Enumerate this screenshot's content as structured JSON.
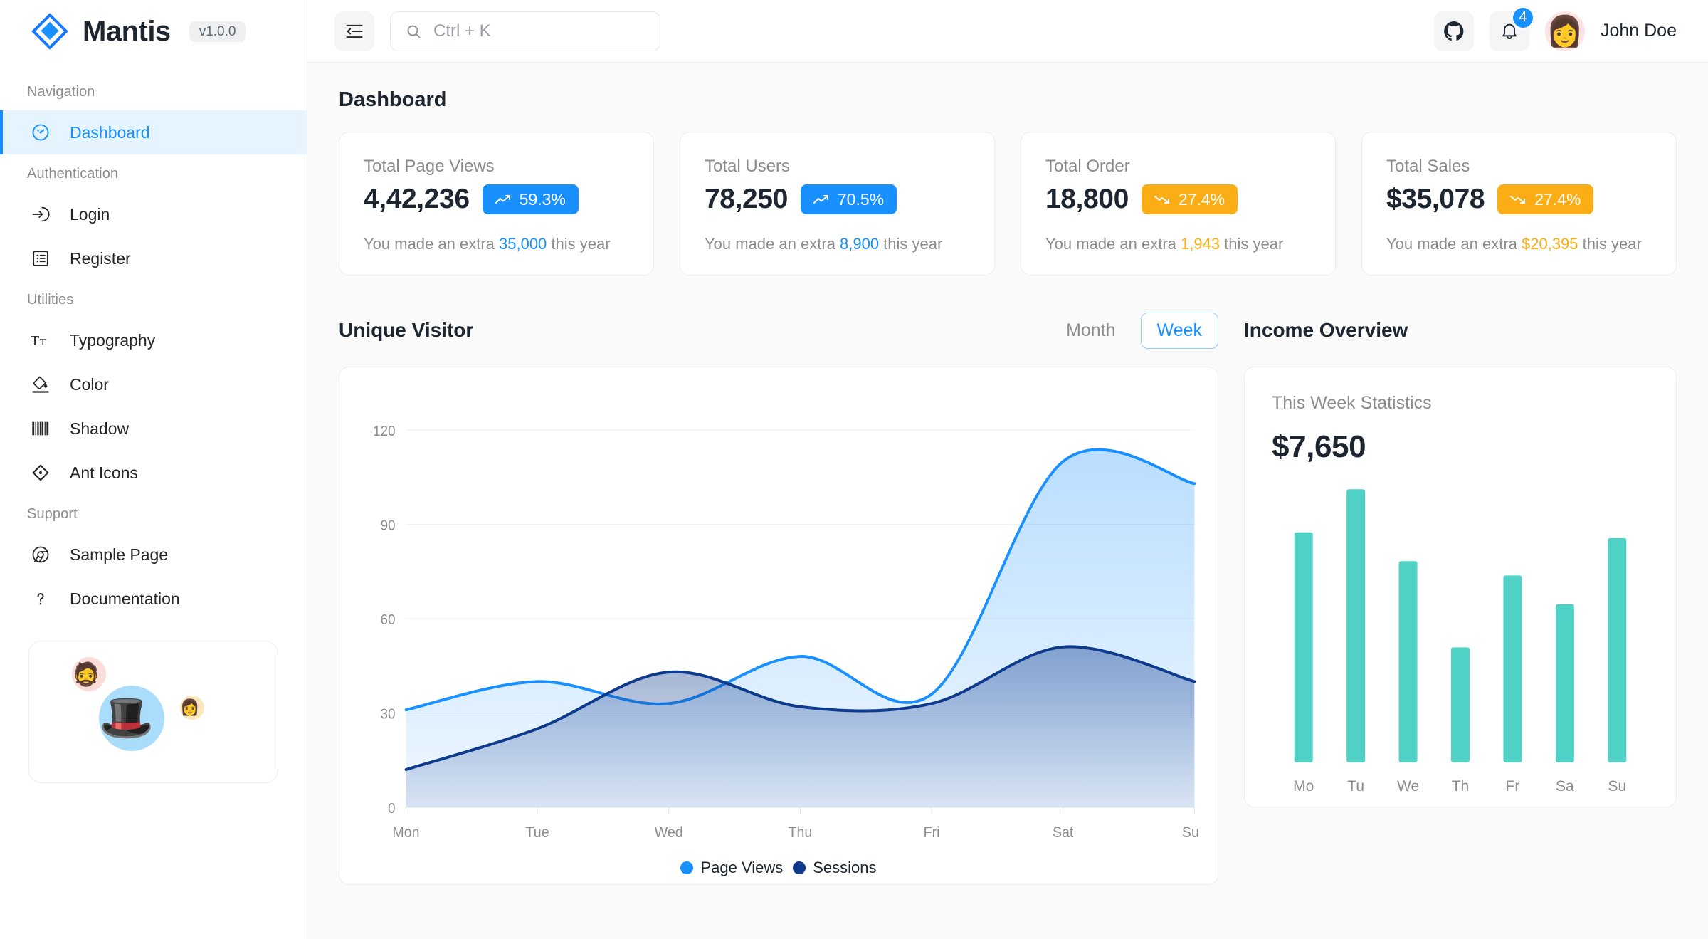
{
  "brand": {
    "name": "Mantis",
    "version": "v1.0.0",
    "logo_icon": "mantis-diamond-logo"
  },
  "sidebar": {
    "groups": [
      {
        "caption": "Navigation",
        "items": [
          {
            "label": "Dashboard",
            "icon": "dashboard-gauge-icon",
            "active": true
          }
        ]
      },
      {
        "caption": "Authentication",
        "items": [
          {
            "label": "Login",
            "icon": "login-arrow-icon",
            "active": false
          },
          {
            "label": "Register",
            "icon": "register-form-icon",
            "active": false
          }
        ]
      },
      {
        "caption": "Utilities",
        "items": [
          {
            "label": "Typography",
            "icon": "typography-icon",
            "active": false
          },
          {
            "label": "Color",
            "icon": "color-fill-icon",
            "active": false
          },
          {
            "label": "Shadow",
            "icon": "shadow-barcode-icon",
            "active": false
          },
          {
            "label": "Ant Icons",
            "icon": "ant-design-icon",
            "active": false
          }
        ]
      },
      {
        "caption": "Support",
        "items": [
          {
            "label": "Sample Page",
            "icon": "chrome-icon",
            "active": false
          },
          {
            "label": "Documentation",
            "icon": "question-mark-icon",
            "active": false
          }
        ]
      }
    ],
    "promo": {
      "avatars": [
        "🧔",
        "🎩",
        "👩"
      ]
    }
  },
  "topbar": {
    "menu_toggle_icon": "sidebar-collapse-icon",
    "search": {
      "placeholder": "Ctrl + K",
      "value": "",
      "icon": "search-icon"
    },
    "github_icon": "github-icon",
    "notifications": {
      "icon": "bell-icon",
      "count": "4"
    },
    "user": {
      "name": "John Doe",
      "avatar_icon": "user-avatar"
    }
  },
  "page": {
    "title": "Dashboard"
  },
  "stats": [
    {
      "label": "Total Page Views",
      "value": "4,42,236",
      "trend": "up",
      "percent": "59.3%",
      "chip_color": "#1890ff",
      "foot_prefix": "You made an extra ",
      "foot_value": "35,000",
      "foot_suffix": " this year",
      "foot_color": "#1890ff"
    },
    {
      "label": "Total Users",
      "value": "78,250",
      "trend": "up",
      "percent": "70.5%",
      "chip_color": "#1890ff",
      "foot_prefix": "You made an extra ",
      "foot_value": "8,900",
      "foot_suffix": " this year",
      "foot_color": "#1890ff"
    },
    {
      "label": "Total Order",
      "value": "18,800",
      "trend": "down",
      "percent": "27.4%",
      "chip_color": "#faad14",
      "foot_prefix": "You made an extra ",
      "foot_value": "1,943",
      "foot_suffix": " this year",
      "foot_color": "#faad14"
    },
    {
      "label": "Total Sales",
      "value": "$35,078",
      "trend": "down",
      "percent": "27.4%",
      "chip_color": "#faad14",
      "foot_prefix": "You made an extra ",
      "foot_value": "$20,395",
      "foot_suffix": " this year",
      "foot_color": "#faad14"
    }
  ],
  "unique_visitor": {
    "title": "Unique Visitor",
    "range_options": [
      "Month",
      "Week"
    ],
    "month_label": "Month",
    "week_label": "Week",
    "selected_range": "Week"
  },
  "income_overview": {
    "title": "Income Overview",
    "sub": "This Week Statistics",
    "amount": "$7,650"
  },
  "chart_data": [
    {
      "type": "area",
      "title": "Unique Visitor",
      "x": [
        "Mon",
        "Tue",
        "Wed",
        "Thu",
        "Fri",
        "Sat",
        "Sun"
      ],
      "series": [
        {
          "name": "Page Views",
          "color": "#1890ff",
          "values": [
            31,
            40,
            33,
            48,
            36,
            110,
            103
          ]
        },
        {
          "name": "Sessions",
          "color": "#0d3a8c",
          "values": [
            12,
            25,
            43,
            32,
            33,
            51,
            40
          ]
        }
      ],
      "ylim": [
        0,
        130
      ],
      "yticks": [
        0,
        30,
        60,
        90,
        120
      ],
      "ytick_labels": [
        "0",
        "30",
        "60",
        "90",
        "120"
      ],
      "xlabel": "",
      "ylabel": "",
      "grid": true,
      "legend": "bottom-center"
    },
    {
      "type": "bar",
      "title": "This Week Statistics",
      "categories": [
        "Mo",
        "Tu",
        "We",
        "Th",
        "Fr",
        "Sa",
        "Su"
      ],
      "values": [
        80,
        95,
        70,
        40,
        65,
        55,
        78
      ],
      "color": "#4fd1c5",
      "ylim": [
        0,
        100
      ],
      "xlabel": "",
      "ylabel": "",
      "grid": false,
      "legend": "none"
    }
  ],
  "colors": {
    "accent": "#1890ff",
    "warning": "#faad14",
    "series_page_views": "#1890ff",
    "series_sessions": "#0d3a8c",
    "bar_teal": "#4fd1c5",
    "sidebar_active_bg": "#e6f4ff"
  }
}
